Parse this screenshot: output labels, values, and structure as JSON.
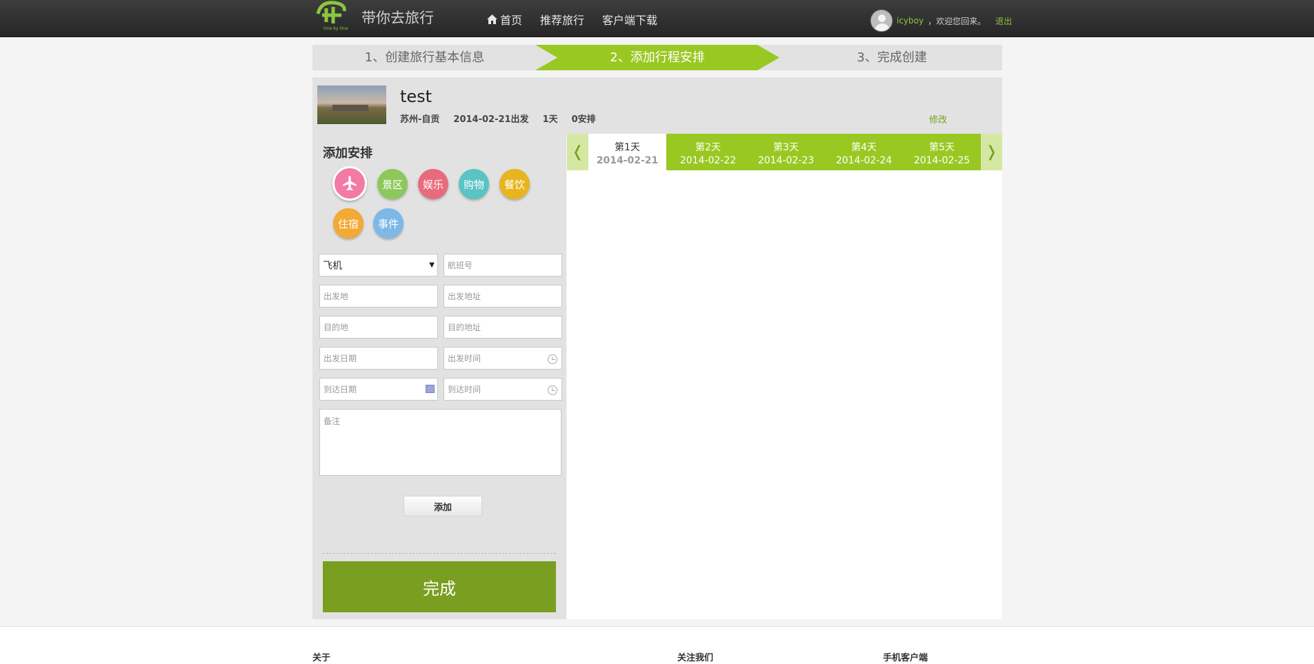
{
  "header": {
    "slogan": "带你去旅行",
    "nav": [
      {
        "label": "首页",
        "icon": "home-icon"
      },
      {
        "label": "推荐旅行"
      },
      {
        "label": "客户端下载"
      }
    ],
    "user": {
      "name": "icyboy",
      "welcome": "，欢迎您回来。",
      "logout": "退出"
    },
    "colors": {
      "brand_green": "#9ac823",
      "dark_green": "#7a9e1f"
    }
  },
  "steps": [
    {
      "label": "1、创建旅行基本信息",
      "active": false
    },
    {
      "label": "2、添加行程安排",
      "active": true
    },
    {
      "label": "3、完成创建",
      "active": false
    }
  ],
  "trip": {
    "title": "test",
    "location": "苏州-自贡",
    "departure": "2014-02-21出发",
    "days": "1天",
    "arrangements": "0安排",
    "edit_label": "修改"
  },
  "add_panel": {
    "title": "添加安排",
    "categories": [
      {
        "label": "飞机",
        "icon": "airplane-icon",
        "color": "#f27aa5"
      },
      {
        "label": "景区",
        "color": "#8cc85a"
      },
      {
        "label": "娱乐",
        "color": "#e86b7c"
      },
      {
        "label": "购物",
        "color": "#5ac3c4"
      },
      {
        "label": "餐饮",
        "color": "#e8b51e"
      },
      {
        "label": "住宿",
        "color": "#f3a934"
      },
      {
        "label": "事件",
        "color": "#7eb8e6"
      }
    ],
    "form": {
      "transport_selected": "飞机",
      "flight_no": "航班号",
      "depart_place": "出发地",
      "depart_address": "出发地址",
      "dest_place": "目的地",
      "dest_address": "目的地址",
      "depart_date": "出发日期",
      "depart_time": "出发时间",
      "arrive_date": "到达日期",
      "arrive_time": "到达时间",
      "note": "备注"
    },
    "add_button": "添加",
    "done_button": "完成"
  },
  "day_tabs": {
    "prev": "❬",
    "next": "❭",
    "days": [
      {
        "label": "第1天",
        "date": "2014-02-21",
        "active": true
      },
      {
        "label": "第2天",
        "date": "2014-02-22",
        "active": false
      },
      {
        "label": "第3天",
        "date": "2014-02-23",
        "active": false
      },
      {
        "label": "第4天",
        "date": "2014-02-24",
        "active": false
      },
      {
        "label": "第5天",
        "date": "2014-02-25",
        "active": false
      }
    ]
  },
  "footer": {
    "about": "关于",
    "follow": "关注我们",
    "mobile": "手机客户端"
  }
}
